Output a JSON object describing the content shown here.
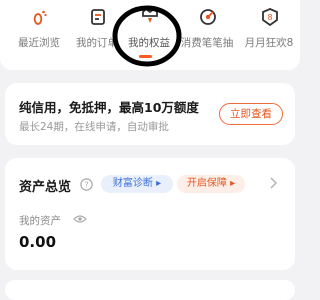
{
  "nav": {
    "items": [
      {
        "label": "最近浏览",
        "icon": "footprint-icon"
      },
      {
        "label": "我的订单",
        "icon": "order-icon"
      },
      {
        "label": "我的权益",
        "icon": "benefit-icon"
      },
      {
        "label": "消费笔笔抽",
        "icon": "lottery-icon"
      },
      {
        "label": "月月狂欢8",
        "icon": "carnival-icon"
      }
    ],
    "active_index": 2
  },
  "loan": {
    "title": "纯信用，免抵押，最高10万额度",
    "subtitle": "最长24期，在线申请，自动审批",
    "button": "立即查看"
  },
  "assets": {
    "title": "资产总览",
    "tag_wealth": "财富诊断 ▸",
    "tag_protect": "开启保障 ▸",
    "my_assets_label": "我的资产",
    "value": "0.00"
  },
  "colors": {
    "accent": "#ff5a1f",
    "blue": "#3a6fd8"
  }
}
